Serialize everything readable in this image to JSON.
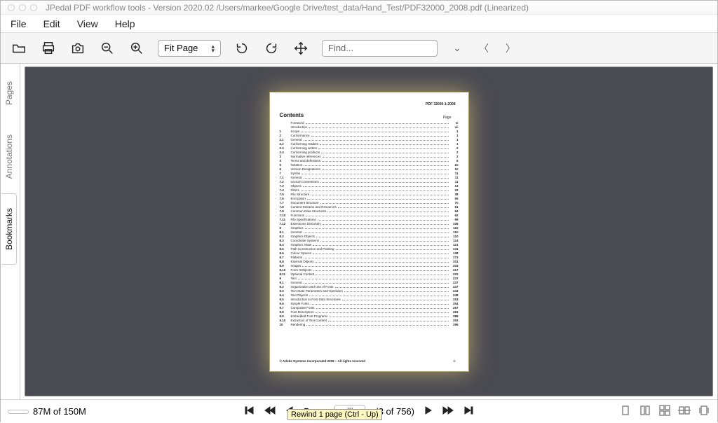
{
  "window": {
    "title": "JPedal PDF workflow tools - Version 2020.02 /Users/markee/Google Drive/test_data/Hand_Test/PDF32000_2008.pdf (Linearized)"
  },
  "menu": {
    "file": "File",
    "edit": "Edit",
    "view": "View",
    "help": "Help"
  },
  "toolbar": {
    "zoom_mode": "Fit Page",
    "find_placeholder": "Find..."
  },
  "side": {
    "pages": "Pages",
    "annotations": "Annotations",
    "bookmarks": "Bookmarks"
  },
  "status": {
    "progress": "87M of 150M",
    "page_label": "Page",
    "page_value": "iii",
    "page_count": "(3 of 756)"
  },
  "tooltip": "Rewind 1 page (Ctrl - Up)",
  "doc": {
    "header": "PDF 32000-1:2008",
    "contents_title": "Contents",
    "page_col_label": "Page",
    "footer": "© Adobe Systems Incorporated 2008 – All rights reserved",
    "footer_page": "iii",
    "toc": [
      {
        "n": "",
        "t": "Foreword",
        "p": "vi"
      },
      {
        "n": "",
        "t": "Introduction",
        "p": "vii"
      },
      {
        "n": "1",
        "t": "Scope",
        "p": "1"
      },
      {
        "n": "2",
        "t": "Conformance",
        "p": "1"
      },
      {
        "n": "2.1",
        "t": "General",
        "p": "1"
      },
      {
        "n": "2.2",
        "t": "Conforming readers",
        "p": "1"
      },
      {
        "n": "2.3",
        "t": "Conforming writers",
        "p": "2"
      },
      {
        "n": "2.4",
        "t": "Conforming products",
        "p": "2"
      },
      {
        "n": "3",
        "t": "Normative references",
        "p": "2"
      },
      {
        "n": "4",
        "t": "Terms and definitions",
        "p": "5"
      },
      {
        "n": "5",
        "t": "Notation",
        "p": "10"
      },
      {
        "n": "6",
        "t": "Version Designations",
        "p": "10"
      },
      {
        "n": "7",
        "t": "Syntax",
        "p": "11"
      },
      {
        "n": "7.1",
        "t": "General",
        "p": "11"
      },
      {
        "n": "7.2",
        "t": "Lexical Conventions",
        "p": "11"
      },
      {
        "n": "7.3",
        "t": "Objects",
        "p": "13"
      },
      {
        "n": "7.4",
        "t": "Filters",
        "p": "22"
      },
      {
        "n": "7.5",
        "t": "File Structure",
        "p": "38"
      },
      {
        "n": "7.6",
        "t": "Encryption",
        "p": "55"
      },
      {
        "n": "7.7",
        "t": "Document Structure",
        "p": "70"
      },
      {
        "n": "7.8",
        "t": "Content Streams and Resources",
        "p": "81"
      },
      {
        "n": "7.9",
        "t": "Common Data Structures",
        "p": "84"
      },
      {
        "n": "7.10",
        "t": "Functions",
        "p": "92"
      },
      {
        "n": "7.11",
        "t": "File Specifications",
        "p": "99"
      },
      {
        "n": "7.12",
        "t": "Extensions Dictionary",
        "p": "108"
      },
      {
        "n": "8",
        "t": "Graphics",
        "p": "110"
      },
      {
        "n": "8.1",
        "t": "General",
        "p": "110"
      },
      {
        "n": "8.2",
        "t": "Graphics Objects",
        "p": "110"
      },
      {
        "n": "8.3",
        "t": "Coordinate Systems",
        "p": "114"
      },
      {
        "n": "8.4",
        "t": "Graphics State",
        "p": "121"
      },
      {
        "n": "8.5",
        "t": "Path Construction and Painting",
        "p": "131"
      },
      {
        "n": "8.6",
        "t": "Colour Spaces",
        "p": "138"
      },
      {
        "n": "8.7",
        "t": "Patterns",
        "p": "173"
      },
      {
        "n": "8.8",
        "t": "External Objects",
        "p": "201"
      },
      {
        "n": "8.9",
        "t": "Images",
        "p": "203"
      },
      {
        "n": "8.10",
        "t": "Form XObjects",
        "p": "217"
      },
      {
        "n": "8.11",
        "t": "Optional Content",
        "p": "222"
      },
      {
        "n": "9",
        "t": "Text",
        "p": "237"
      },
      {
        "n": "9.1",
        "t": "General",
        "p": "237"
      },
      {
        "n": "9.2",
        "t": "Organization and Use of Fonts",
        "p": "237"
      },
      {
        "n": "9.3",
        "t": "Text State Parameters and Operators",
        "p": "243"
      },
      {
        "n": "9.4",
        "t": "Text Objects",
        "p": "248"
      },
      {
        "n": "9.5",
        "t": "Introduction to Font Data Structures",
        "p": "253"
      },
      {
        "n": "9.6",
        "t": "Simple Fonts",
        "p": "254"
      },
      {
        "n": "9.7",
        "t": "Composite Fonts",
        "p": "267"
      },
      {
        "n": "9.8",
        "t": "Font Descriptors",
        "p": "281"
      },
      {
        "n": "9.9",
        "t": "Embedded Font Programs",
        "p": "288"
      },
      {
        "n": "9.10",
        "t": "Extraction of Text Content",
        "p": "292"
      },
      {
        "n": "10",
        "t": "Rendering",
        "p": "296"
      }
    ]
  }
}
